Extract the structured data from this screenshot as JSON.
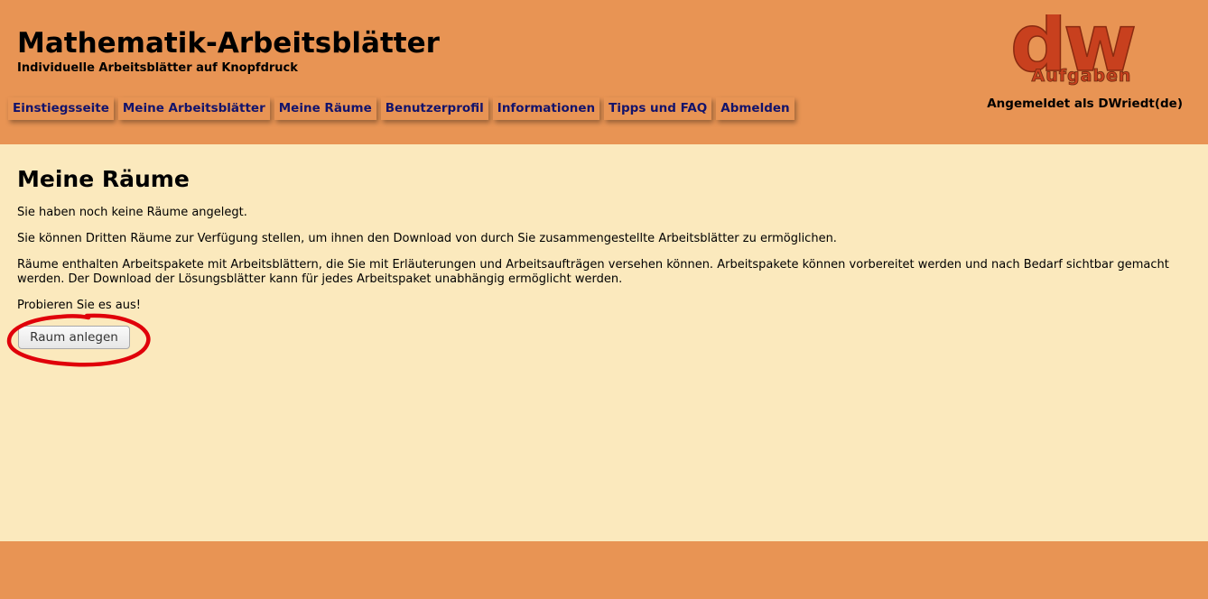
{
  "header": {
    "title": "Mathematik-Arbeitsblätter",
    "subtitle": "Individuelle Arbeitsblätter auf Knopfdruck",
    "logo": {
      "big_text": "dw",
      "small_text": "Aufgaben"
    },
    "login_status": "Angemeldet als DWriedt(de)"
  },
  "nav": {
    "items": [
      {
        "label": "Einstiegsseite"
      },
      {
        "label": "Meine Arbeitsblätter"
      },
      {
        "label": "Meine Räume"
      },
      {
        "label": "Benutzerprofil"
      },
      {
        "label": "Informationen"
      },
      {
        "label": "Tipps und FAQ"
      },
      {
        "label": "Abmelden"
      }
    ]
  },
  "main": {
    "title": "Meine Räume",
    "paragraphs": [
      "Sie haben noch keine Räume angelegt.",
      "Sie können Dritten Räume zur Verfügung stellen, um ihnen den Download von durch Sie zusammengestellte Arbeitsblätter zu ermöglichen.",
      "Räume enthalten Arbeitspakete mit Arbeitsblättern, die Sie mit Erläuterungen und Arbeitsaufträgen versehen können. Arbeitspakete können vorbereitet werden und nach Bedarf sichtbar gemacht werden. Der Download der Lösungsblätter kann für jedes Arbeitspaket unabhängig ermöglicht werden.",
      "Probieren Sie es aus!"
    ],
    "create_button_label": "Raum anlegen"
  },
  "colors": {
    "header_bg": "#e89454",
    "content_bg": "#fbe9bd",
    "nav_text": "#13136b",
    "logo_red": "#c8401e",
    "annotation_red": "#e0000a"
  }
}
